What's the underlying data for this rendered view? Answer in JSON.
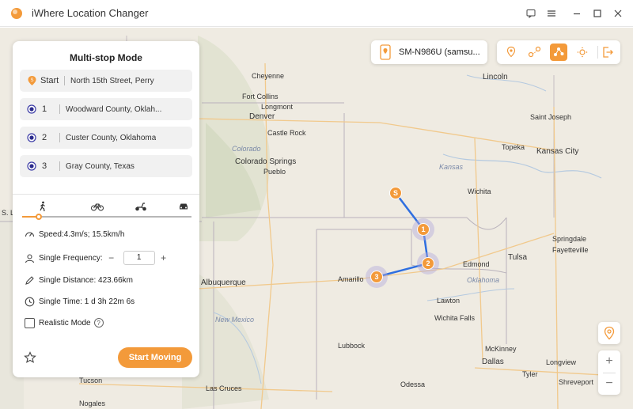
{
  "app": {
    "title": "iWhere Location Changer"
  },
  "panel": {
    "title": "Multi-stop Mode",
    "stops": [
      {
        "label": "Start",
        "address": "North 15th Street, Perry"
      },
      {
        "label": "1",
        "address": "Woodward County, Oklah..."
      },
      {
        "label": "2",
        "address": "Custer County, Oklahoma"
      },
      {
        "label": "3",
        "address": "Gray County, Texas"
      }
    ],
    "speed_fraction": 0.1,
    "speed": "Speed:4.3m/s; 15.5km/h",
    "frequency_label": "Single Frequency:",
    "frequency_value": "1",
    "distance": "Single Distance: 423.66km",
    "time": "Single Time: 1 d 3h 22m 6s",
    "realistic_label": "Realistic Mode",
    "start_button": "Start Moving"
  },
  "device": {
    "name": "SM-N986U (samsu..."
  },
  "map": {
    "cities": [
      "Cheyenne",
      "Lincoln",
      "Fort Collins",
      "Longmont",
      "Denver",
      "Castle Rock",
      "Colorado Springs",
      "Pueblo",
      "Saint Joseph",
      "Topeka",
      "Kansas City",
      "Wichita",
      "Edmond",
      "Tulsa",
      "Fayetteville",
      "Amarillo",
      "Albuquerque",
      "Lawton",
      "Wichita Falls",
      "Lubbock",
      "McKinney",
      "Dallas",
      "Tucson",
      "Las Cruces",
      "Shreveport",
      "Tyler",
      "Odessa",
      "Nogales",
      "Longview",
      "Springdale",
      "S. Lake City"
    ],
    "regions": [
      "Colorado",
      "Kansas",
      "Oklahoma",
      "New Mexico"
    ],
    "markers": [
      "S",
      "1",
      "2",
      "3"
    ]
  }
}
